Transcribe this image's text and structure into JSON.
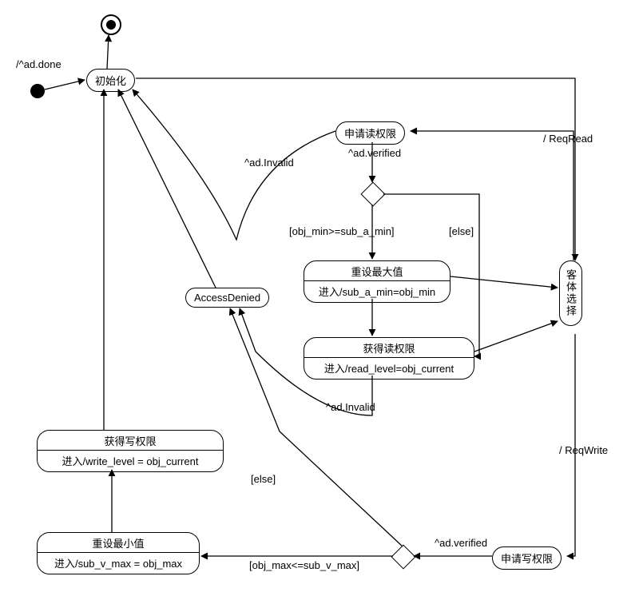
{
  "states": {
    "init": "初始化",
    "req_read": "申请读权限",
    "access_denied": "AccessDenied",
    "reset_max_title": "重设最大值",
    "reset_max_body": "进入/sub_a_min=obj_min",
    "got_read_title": "获得读权限",
    "got_read_body": "进入/read_level=obj_current",
    "object_select": "客体选择",
    "got_write_title": "获得写权限",
    "got_write_body": "进入/write_level = obj_current",
    "reset_min_title": "重设最小值",
    "reset_min_body": "进入/sub_v_max = obj_max",
    "req_write": "申请写权限"
  },
  "labels": {
    "ad_done": "/^ad.done",
    "ad_invalid1": "^ad.Invalid",
    "ad_verified1": "^ad.verified",
    "guard_read": "[obj_min>=sub_a_min]",
    "else1": "[else]",
    "req_read": "/ ReqRead",
    "ad_invalid2": "^ad.Invalid",
    "req_write": "/ ReqWrite",
    "else2": "[else]",
    "guard_write": "[obj_max<=sub_v_max]",
    "ad_verified2": "^ad.verified"
  }
}
